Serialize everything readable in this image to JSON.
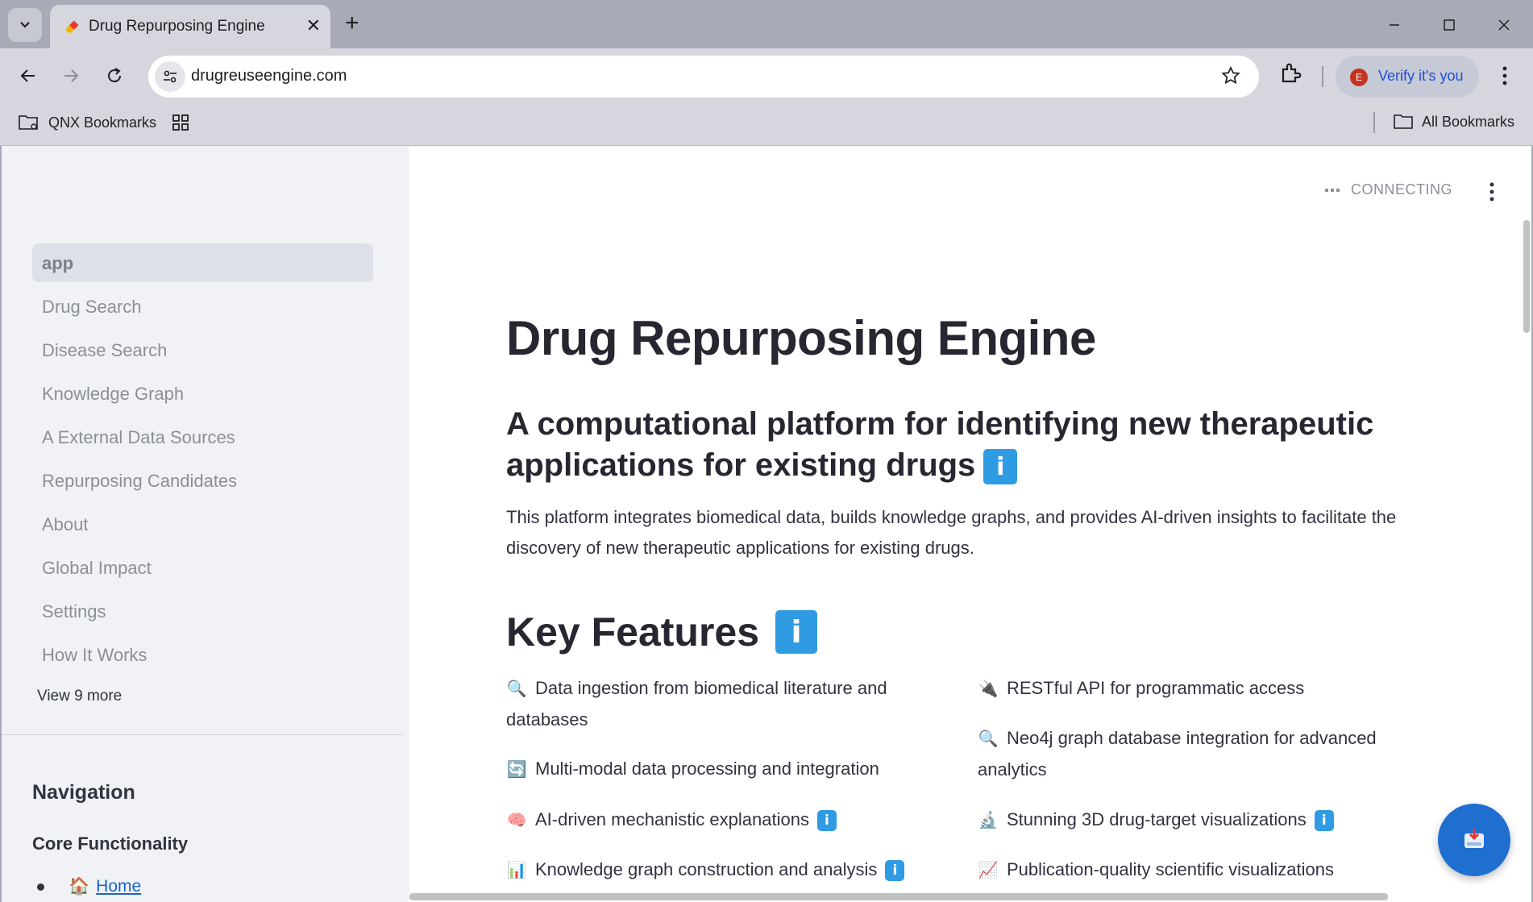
{
  "browser": {
    "tab_title": "Drug Repurposing Engine",
    "url": "drugreuseengine.com",
    "profile_initial": "E",
    "profile_label": "Verify it's you",
    "bookmarks": {
      "folder": "QNX Bookmarks",
      "all": "All Bookmarks"
    }
  },
  "sidebar": {
    "items": [
      {
        "label": "app",
        "active": true
      },
      {
        "label": "Drug Search"
      },
      {
        "label": "Disease Search"
      },
      {
        "label": "Knowledge Graph"
      },
      {
        "label": "A External Data Sources"
      },
      {
        "label": "Repurposing Candidates"
      },
      {
        "label": "About"
      },
      {
        "label": "Global Impact"
      },
      {
        "label": "Settings"
      },
      {
        "label": "How It Works"
      }
    ],
    "view_more": "View 9 more",
    "navigation_heading": "Navigation",
    "core_heading": "Core Functionality",
    "home_link": {
      "emoji": "🏠",
      "label": "Home"
    }
  },
  "header": {
    "status": "CONNECTING"
  },
  "main": {
    "title": "Drug Repurposing Engine",
    "subtitle": "A computational platform for identifying new therapeutic applications for existing drugs",
    "description": "This platform integrates biomedical data, builds knowledge graphs, and provides AI-driven insights to facilitate the discovery of new therapeutic applications for existing drugs.",
    "features_heading": "Key Features",
    "info_glyph": "i",
    "features_left": [
      {
        "emoji": "🔍",
        "text": "Data ingestion from biomedical literature and databases"
      },
      {
        "emoji": "🔄",
        "text": "Multi-modal data processing and integration"
      },
      {
        "emoji": "🧠",
        "text": "AI-driven mechanistic explanations",
        "info": true
      },
      {
        "emoji": "📊",
        "text": "Knowledge graph construction and analysis",
        "info": true
      }
    ],
    "features_right": [
      {
        "emoji": "🔌",
        "text": "RESTful API for programmatic access"
      },
      {
        "emoji": "🔍",
        "text": "Neo4j graph database integration for advanced analytics"
      },
      {
        "emoji": "🔬",
        "text": "Stunning 3D drug-target visualizations",
        "info": true
      },
      {
        "emoji": "📈",
        "text": "Publication-quality scientific visualizations"
      }
    ]
  },
  "colors": {
    "accent": "#2f9be3",
    "fab": "#1f6fd0",
    "link": "#1c64c8"
  }
}
